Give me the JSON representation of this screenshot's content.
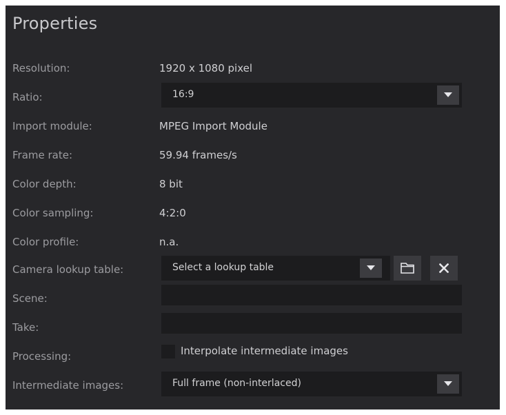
{
  "panel": {
    "title": "Properties"
  },
  "rows": {
    "resolution": {
      "label": "Resolution:",
      "value": "1920 x 1080 pixel"
    },
    "ratio": {
      "label": "Ratio:",
      "value": "16:9"
    },
    "import_module": {
      "label": "Import module:",
      "value": "MPEG Import Module"
    },
    "frame_rate": {
      "label": "Frame rate:",
      "value": "59.94 frames/s"
    },
    "color_depth": {
      "label": "Color depth:",
      "value": "8 bit"
    },
    "color_sampling": {
      "label": "Color sampling:",
      "value": "4:2:0"
    },
    "color_profile": {
      "label": "Color profile:",
      "value": "n.a."
    },
    "camera_lut": {
      "label": "Camera lookup table:",
      "value": "Select a lookup table"
    },
    "scene": {
      "label": "Scene:",
      "value": ""
    },
    "take": {
      "label": "Take:",
      "value": ""
    },
    "processing": {
      "label": "Processing:",
      "checkbox_label": "Interpolate intermediate images",
      "checked": false
    },
    "intermediate_images": {
      "label": "Intermediate images:",
      "value": "Full frame (non-interlaced)"
    }
  },
  "icons": {
    "dropdown": "triangle-down-icon",
    "folder": "folder-icon",
    "close": "x-icon"
  },
  "colors": {
    "panel_bg": "#27272a",
    "field_bg": "#1c1c1e",
    "button_bg": "#3c3c40",
    "label_text": "#9c9ca0",
    "value_text": "#cfcfd2"
  }
}
